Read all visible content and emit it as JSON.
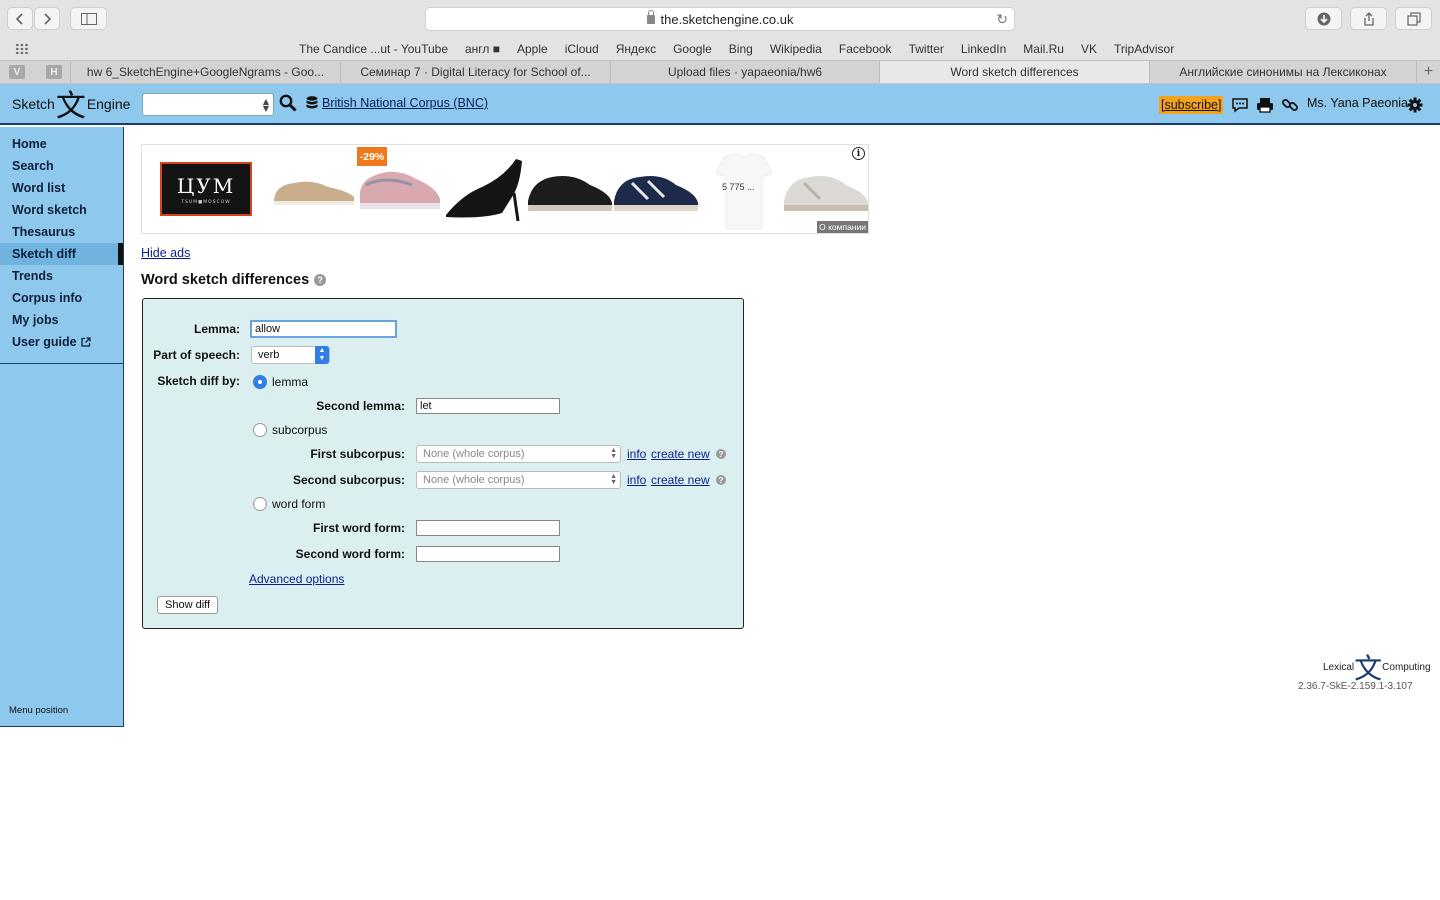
{
  "browser": {
    "url": "the.sketchengine.co.uk",
    "favorites": [
      "The Candice ...ut - YouTube",
      "англ ■",
      "Apple",
      "iCloud",
      "Яндекс",
      "Google",
      "Bing",
      "Wikipedia",
      "Facebook",
      "Twitter",
      "LinkedIn",
      "Mail.Ru",
      "VK",
      "TripAdvisor"
    ],
    "pinned_tabs": [
      "V",
      "H"
    ],
    "tabs": [
      {
        "label": "hw 6_SketchEngine+GoogleNgrams - Goo..."
      },
      {
        "label": "Семинар 7 · Digital Literacy for School of..."
      },
      {
        "label": "Upload files · yapaeonia/hw6"
      },
      {
        "label": "Word sketch differences"
      },
      {
        "label": "Английские синонимы на Лексиконах"
      }
    ]
  },
  "header": {
    "logo_left": "Sketch",
    "logo_glyph": "文",
    "logo_right": "Engine",
    "corpus": "British National Corpus (BNC)",
    "subscribe": "[subscribe]",
    "user": "Ms. Yana Paeonia"
  },
  "sidebar": {
    "items": [
      {
        "label": "Home"
      },
      {
        "label": "Search"
      },
      {
        "label": "Word list"
      },
      {
        "label": "Word sketch"
      },
      {
        "label": "Thesaurus"
      },
      {
        "label": "Sketch diff"
      },
      {
        "label": "Trends"
      },
      {
        "label": "Corpus info"
      },
      {
        "label": "My jobs"
      },
      {
        "label": "User guide"
      }
    ],
    "menu_position": "Menu position"
  },
  "ad": {
    "brand": "ЦУМ",
    "brand_sub": "TSUM■MOSCOW",
    "discount": "-29%",
    "price": "5 775 ...",
    "about": "О компании"
  },
  "hide_ads": "Hide ads",
  "title": "Word sketch differences",
  "form": {
    "lemma_label": "Lemma:",
    "lemma_value": "allow",
    "pos_label": "Part of speech:",
    "pos_value": "verb",
    "diff_by_label": "Sketch diff by:",
    "opt_lemma": "lemma",
    "second_lemma_label": "Second lemma:",
    "second_lemma_value": "let",
    "opt_subcorpus": "subcorpus",
    "first_subcorpus_label": "First subcorpus:",
    "second_subcorpus_label": "Second subcorpus:",
    "subcorpus_value": "None (whole corpus)",
    "info": "info",
    "create_new": "create new",
    "opt_wordform": "word form",
    "first_wordform_label": "First word form:",
    "second_wordform_label": "Second word form:",
    "advanced": "Advanced options",
    "submit": "Show diff"
  },
  "footer": {
    "lc_left": "Lexical",
    "lc_glyph": "文",
    "lc_right": "Computing",
    "version": "2.36.7-SkE-2.159.1-3.107"
  }
}
